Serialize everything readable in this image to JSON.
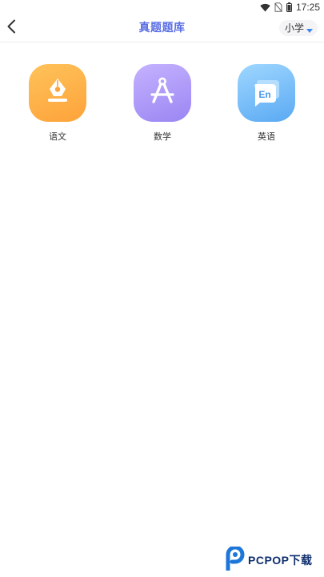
{
  "status_bar": {
    "time": "17:25",
    "icons": [
      "wifi-icon",
      "no-sim-icon",
      "battery-icon"
    ]
  },
  "header": {
    "title": "真题题库",
    "back_icon": "chevron-left-icon",
    "grade_selector": {
      "value": "小学",
      "icon": "caret-down-icon"
    }
  },
  "subjects": [
    {
      "label": "语文",
      "icon": "fountain-pen-icon",
      "color": "#fdaa43"
    },
    {
      "label": "数学",
      "icon": "compass-icon",
      "color": "#a895f7"
    },
    {
      "label": "英语",
      "icon": "en-speech-bubble-icon",
      "color": "#6fb7f6"
    }
  ],
  "colors": {
    "accent": "#5b6fe3",
    "grade_caret": "#3f86f0"
  },
  "watermark": {
    "text": "PCPOP下载",
    "logo_icon": "pcpop-logo-icon"
  }
}
